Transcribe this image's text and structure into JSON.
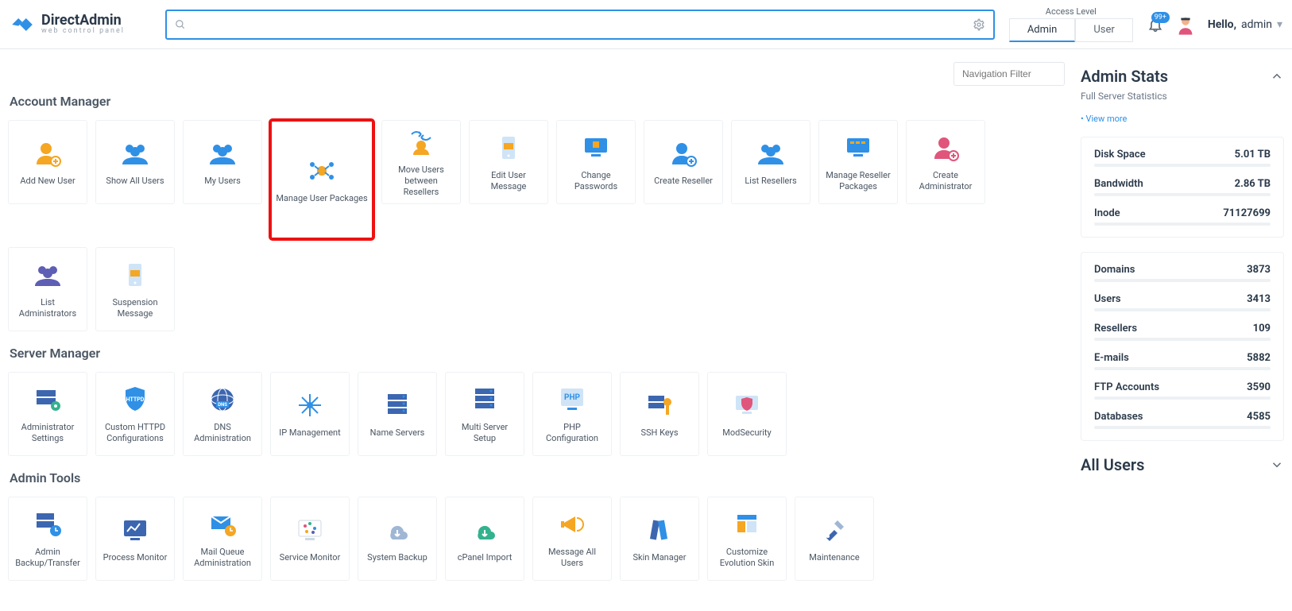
{
  "brand": {
    "name": "DirectAdmin",
    "tagline": "web control panel"
  },
  "search": {
    "placeholder": ""
  },
  "access": {
    "title": "Access Level",
    "tab_admin": "Admin",
    "tab_user": "User"
  },
  "notifications": {
    "badge": "99+"
  },
  "user": {
    "greeting": "Hello,",
    "name": "admin"
  },
  "nav_filter": {
    "placeholder": "Navigation Filter"
  },
  "sections": {
    "account_manager": {
      "title": "Account Manager",
      "items": [
        {
          "name": "add-new-user",
          "label": "Add New User",
          "icon": "user-plus",
          "color": "#f5a623"
        },
        {
          "name": "show-all-users",
          "label": "Show All Users",
          "icon": "users",
          "color": "#2f90e6"
        },
        {
          "name": "my-users",
          "label": "My Users",
          "icon": "users",
          "color": "#2f90e6"
        },
        {
          "name": "manage-user-packages",
          "label": "Manage User Packages",
          "icon": "nodes",
          "color": "#f5a623",
          "highlighted": true
        },
        {
          "name": "move-users-between-resellers",
          "label": "Move Users between Resellers",
          "icon": "transfer",
          "color": "#f5a623"
        },
        {
          "name": "edit-user-message",
          "label": "Edit User Message",
          "icon": "phone-msg",
          "color": "#f5a623"
        },
        {
          "name": "change-passwords",
          "label": "Change Passwords",
          "icon": "monitor-lock",
          "color": "#2f90e6"
        },
        {
          "name": "create-reseller",
          "label": "Create Reseller",
          "icon": "user-plus",
          "color": "#2f90e6"
        },
        {
          "name": "list-resellers",
          "label": "List Resellers",
          "icon": "users",
          "color": "#2f90e6"
        },
        {
          "name": "manage-reseller-packages",
          "label": "Manage Reseller Packages",
          "icon": "monitor-grid",
          "color": "#2f90e6"
        },
        {
          "name": "create-administrator",
          "label": "Create Administrator",
          "icon": "user-plus",
          "color": "#e0557b"
        },
        {
          "name": "list-administrators",
          "label": "List Administrators",
          "icon": "users",
          "color": "#5e5eb5"
        },
        {
          "name": "suspension-message",
          "label": "Suspension Message",
          "icon": "phone-msg",
          "color": "#f5a623"
        }
      ]
    },
    "server_manager": {
      "title": "Server Manager",
      "items": [
        {
          "name": "administrator-settings",
          "label": "Administrator Settings",
          "icon": "server-gear",
          "color": "#3c66b0"
        },
        {
          "name": "custom-httpd-configurations",
          "label": "Custom HTTPD Configurations",
          "icon": "shield",
          "color": "#2f90e6"
        },
        {
          "name": "dns-administration",
          "label": "DNS Administration",
          "icon": "globe-dns",
          "color": "#3c66b0"
        },
        {
          "name": "ip-management",
          "label": "IP Management",
          "icon": "snowflake",
          "color": "#2f90e6"
        },
        {
          "name": "name-servers",
          "label": "Name Servers",
          "icon": "servers",
          "color": "#3c66b0"
        },
        {
          "name": "multi-server-setup",
          "label": "Multi Server Setup",
          "icon": "servers",
          "color": "#3c66b0"
        },
        {
          "name": "php-configuration",
          "label": "PHP Configuration",
          "icon": "php",
          "color": "#2f90e6"
        },
        {
          "name": "ssh-keys",
          "label": "SSH Keys",
          "icon": "server-key",
          "color": "#f5a623"
        },
        {
          "name": "modsecurity",
          "label": "ModSecurity",
          "icon": "monitor-shield",
          "color": "#e0557b"
        }
      ]
    },
    "admin_tools": {
      "title": "Admin Tools",
      "items": [
        {
          "name": "admin-backup-transfer",
          "label": "Admin Backup/Transfer",
          "icon": "server-clock",
          "color": "#3c66b0"
        },
        {
          "name": "process-monitor",
          "label": "Process Monitor",
          "icon": "monitor-chart",
          "color": "#3c66b0"
        },
        {
          "name": "mail-queue-administration",
          "label": "Mail Queue Administration",
          "icon": "mail-clock",
          "color": "#2f90e6"
        },
        {
          "name": "service-monitor",
          "label": "Service Monitor",
          "icon": "monitor-dots",
          "color": "#f5a623"
        },
        {
          "name": "system-backup",
          "label": "System Backup",
          "icon": "cloud-down",
          "color": "#9fb7d4"
        },
        {
          "name": "cpanel-import",
          "label": "cPanel Import",
          "icon": "cloud-down",
          "color": "#33b28f"
        },
        {
          "name": "message-all-users",
          "label": "Message All Users",
          "icon": "megaphone",
          "color": "#f5a623"
        },
        {
          "name": "skin-manager",
          "label": "Skin Manager",
          "icon": "palette",
          "color": "#3c66b0"
        },
        {
          "name": "customize-evolution-skin",
          "label": "Customize Evolution Skin",
          "icon": "layout",
          "color": "#2f90e6"
        },
        {
          "name": "maintenance",
          "label": "Maintenance",
          "icon": "tools",
          "color": "#3c66b0"
        }
      ]
    }
  },
  "stats": {
    "title": "Admin Stats",
    "subtitle": "Full Server Statistics",
    "view_more": "• View more",
    "group1": [
      {
        "name": "Disk Space",
        "value": "5.01 TB"
      },
      {
        "name": "Bandwidth",
        "value": "2.86 TB"
      },
      {
        "name": "Inode",
        "value": "71127699"
      }
    ],
    "group2": [
      {
        "name": "Domains",
        "value": "3873"
      },
      {
        "name": "Users",
        "value": "3413"
      },
      {
        "name": "Resellers",
        "value": "109"
      },
      {
        "name": "E-mails",
        "value": "5882"
      },
      {
        "name": "FTP Accounts",
        "value": "3590"
      },
      {
        "name": "Databases",
        "value": "4585"
      }
    ],
    "all_users_title": "All Users"
  }
}
